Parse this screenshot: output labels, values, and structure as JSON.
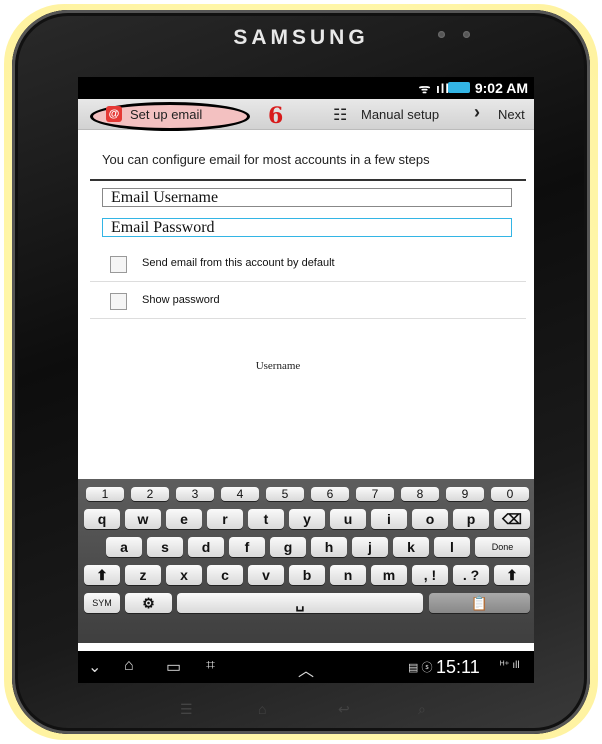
{
  "device": {
    "brand": "SAMSUNG"
  },
  "status_bar": {
    "time": "9:02 AM",
    "icons": "ᯤ ıll"
  },
  "action_bar": {
    "setup_label": "Set up email",
    "step_number": "6",
    "manual_label": "Manual setup",
    "next_label": "Next"
  },
  "form": {
    "intro": "You can configure email for most accounts in a few steps",
    "username_value": "Email Username",
    "password_value": "Email Password",
    "default_label": "Send email from this account by default",
    "show_password_label": "Show password",
    "hint": "Username"
  },
  "keyboard": {
    "numbers": [
      "1",
      "2",
      "3",
      "4",
      "5",
      "6",
      "7",
      "8",
      "9",
      "0"
    ],
    "row1": [
      "q",
      "w",
      "e",
      "r",
      "t",
      "y",
      "u",
      "i",
      "o",
      "p"
    ],
    "row2": [
      "a",
      "s",
      "d",
      "f",
      "g",
      "h",
      "j",
      "k",
      "l"
    ],
    "row3": [
      "z",
      "x",
      "c",
      "v",
      "b",
      "n",
      "m"
    ],
    "done_label": "Done",
    "sym_label": "SYM",
    "comma_label": ", !",
    "period_label": ". ?"
  },
  "nav_bar": {
    "clock": "15:11",
    "status_icons": "▤ ⓢ",
    "right_icons": "ᴴ⁺ ıll"
  }
}
